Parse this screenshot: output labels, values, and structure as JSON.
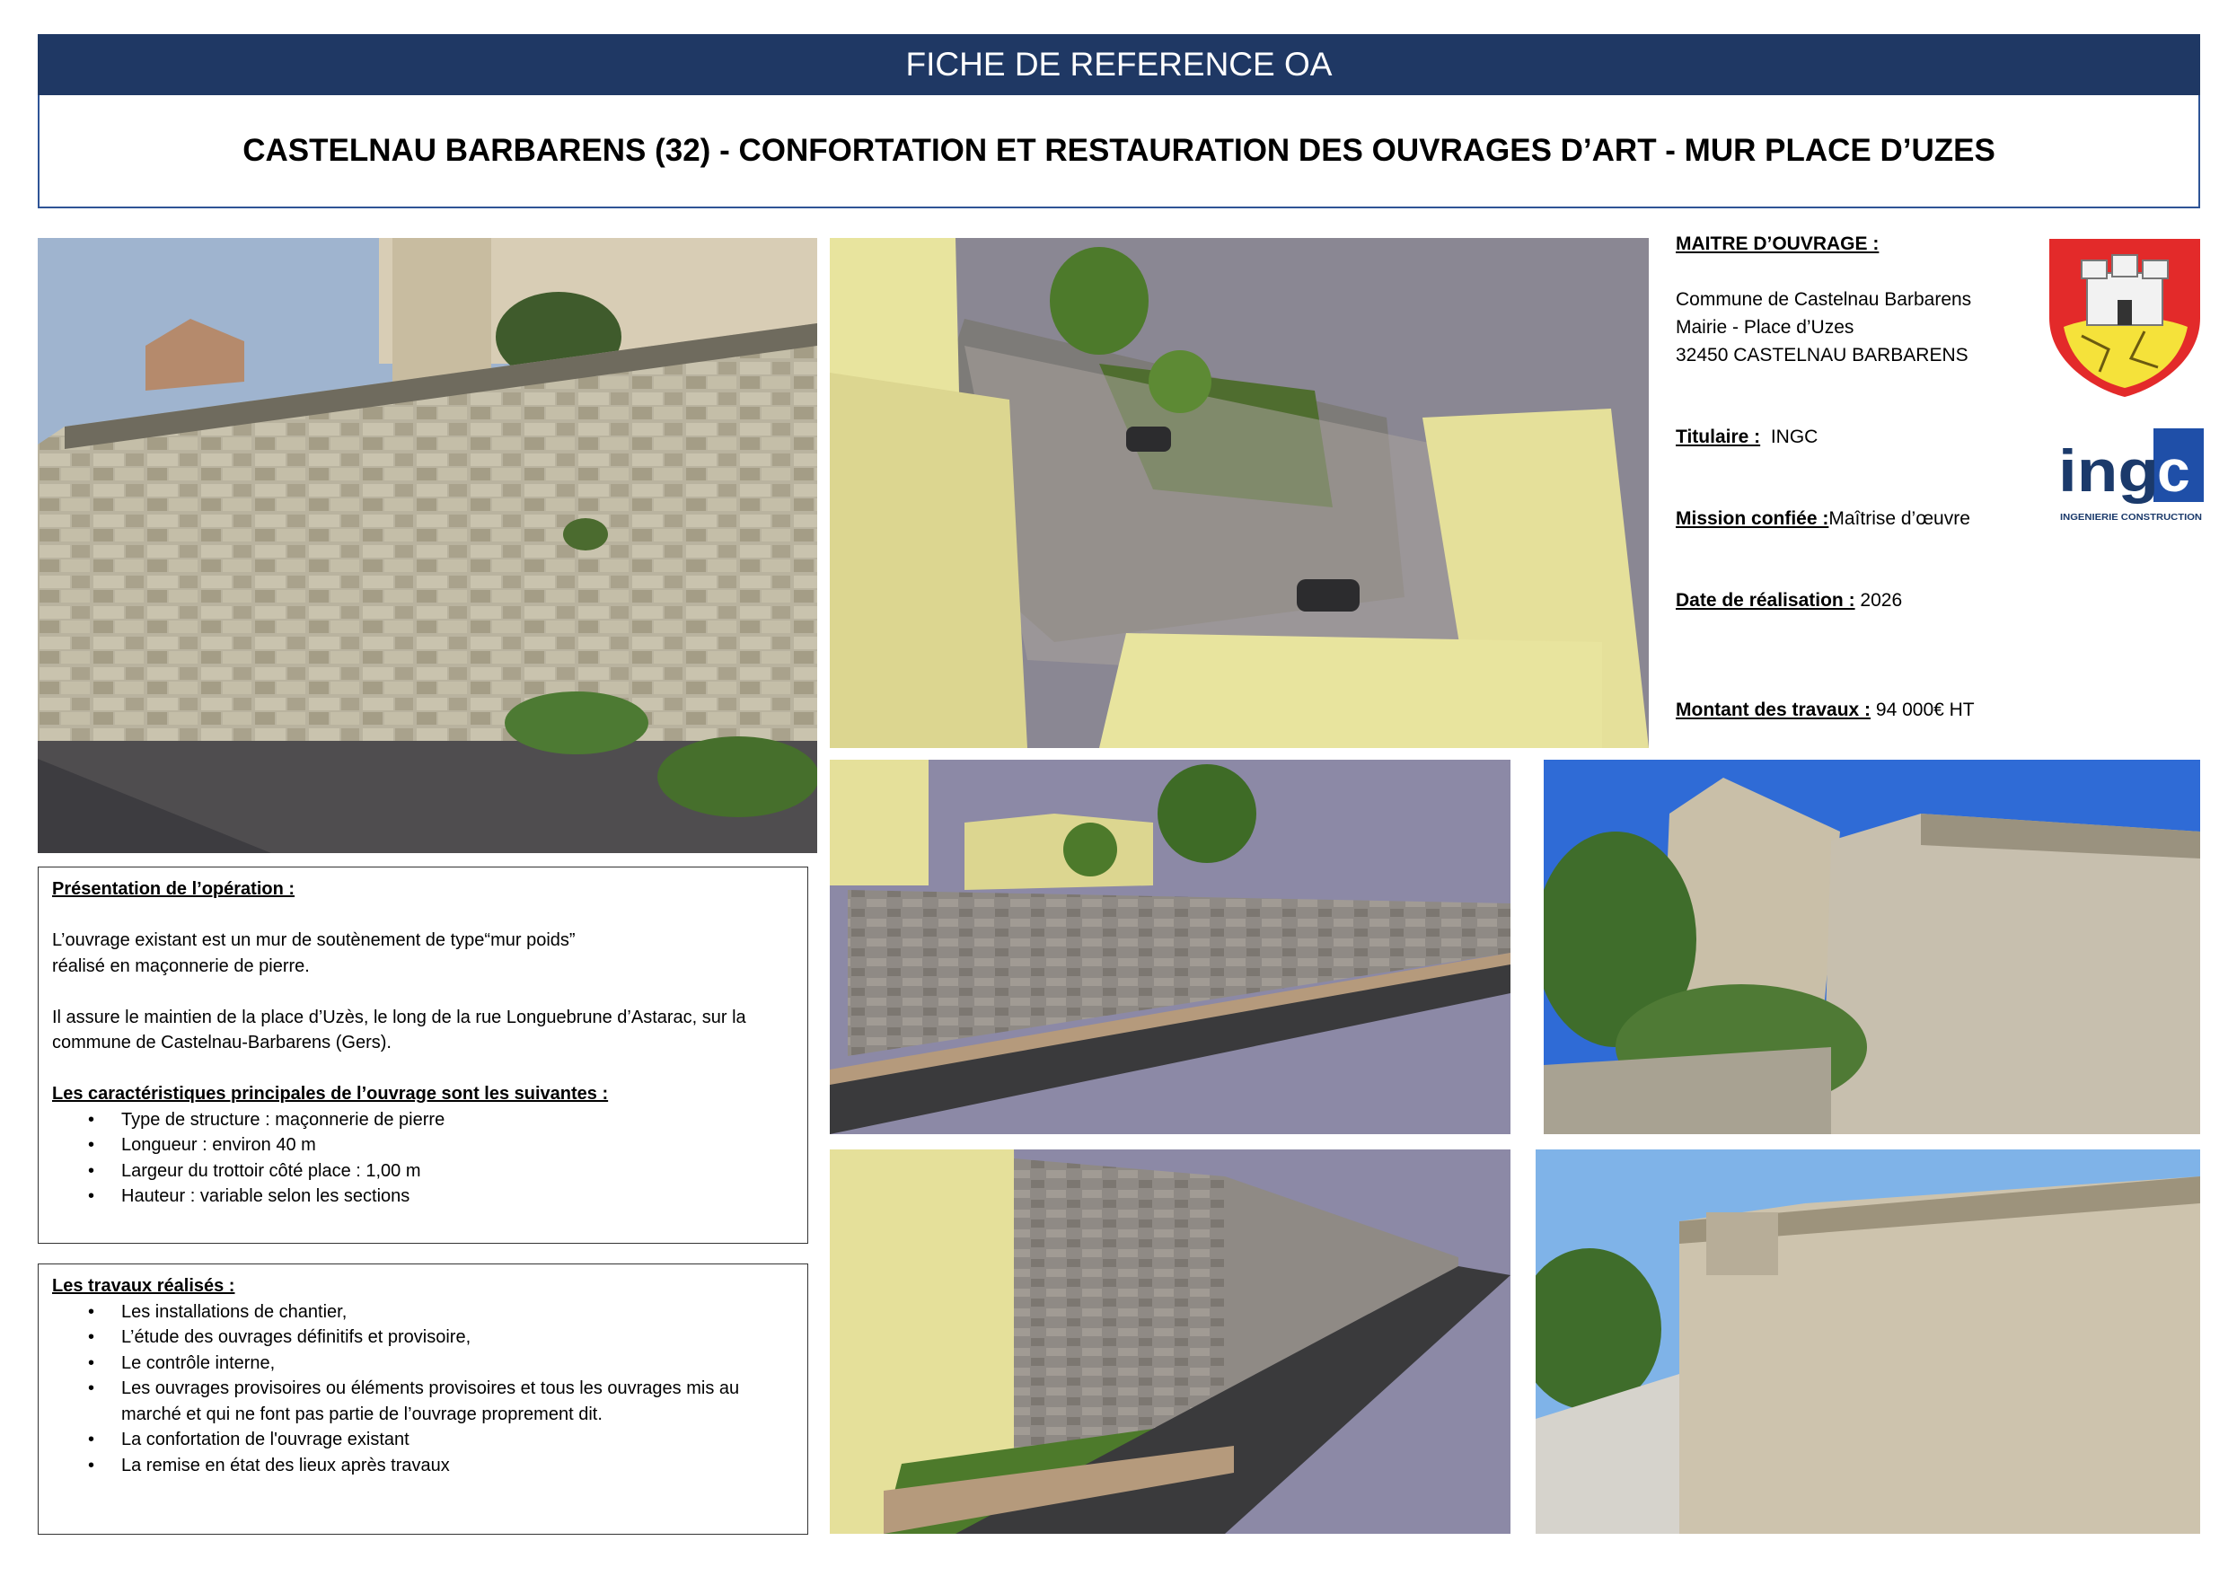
{
  "header": {
    "banner": "FICHE DE REFERENCE OA",
    "title": "CASTELNAU BARBARENS (32) - CONFORTATION ET RESTAURATION DES OUVRAGES D’ART - MUR PLACE D’UZES"
  },
  "info": {
    "maitre_label": "MAITRE D’OUVRAGE :",
    "maitre_lines": [
      "Commune de Castelnau Barbarens",
      "Mairie - Place d’Uzes",
      "32450 CASTELNAU BARBARENS"
    ],
    "titulaire_label": "Titulaire :",
    "titulaire_value": "INGC",
    "mission_label": "Mission confiée :",
    "mission_value": "Maîtrise d’œuvre",
    "date_label": "Date de réalisation :",
    "date_value": "2026",
    "montant_label": "Montant des travaux :",
    "montant_value": "94 000€ HT"
  },
  "logo": {
    "text": "ingc",
    "subtitle": "INGENIERIE CONSTRUCTION",
    "color_dark": "#1b3a6b",
    "color_box": "#1f4fa8"
  },
  "presentation": {
    "heading": "Présentation de l’opération :",
    "para1_line1": "L’ouvrage existant est un mur de soutènement de type“mur poids”",
    "para1_line2": "réalisé en maçonnerie de pierre.",
    "para2_line1": "Il assure le maintien de la place d’Uzès, le long de la rue Longuebrune d’Astarac, sur la",
    "para2_line2": "commune de Castelnau-Barbarens (Gers).",
    "list_heading": "Les caractéristiques principales de l’ouvrage sont les suivantes :",
    "items": [
      "Type de structure : maçonnerie de pierre",
      "Longueur : environ 40 m",
      "Largeur du trottoir côté place : 1,00 m",
      "Hauteur : variable selon les sections"
    ]
  },
  "travaux": {
    "heading": "Les travaux réalisés :",
    "items": [
      "Les installations de chantier,",
      "L’étude des ouvrages définitifs et provisoire,",
      "Le contrôle interne,",
      "Les ouvrages provisoires ou éléments provisoires et tous les ouvrages mis au",
      "marché et qui ne font pas partie de l’ouvrage proprement dit.",
      "La confortation de l'ouvrage existant",
      "La remise en état des lieux après travaux"
    ]
  },
  "colors": {
    "banner": "#1f3864",
    "title_border": "#2f5496",
    "coat_red": "#e32a2a",
    "coat_yellow": "#f5e23a"
  }
}
